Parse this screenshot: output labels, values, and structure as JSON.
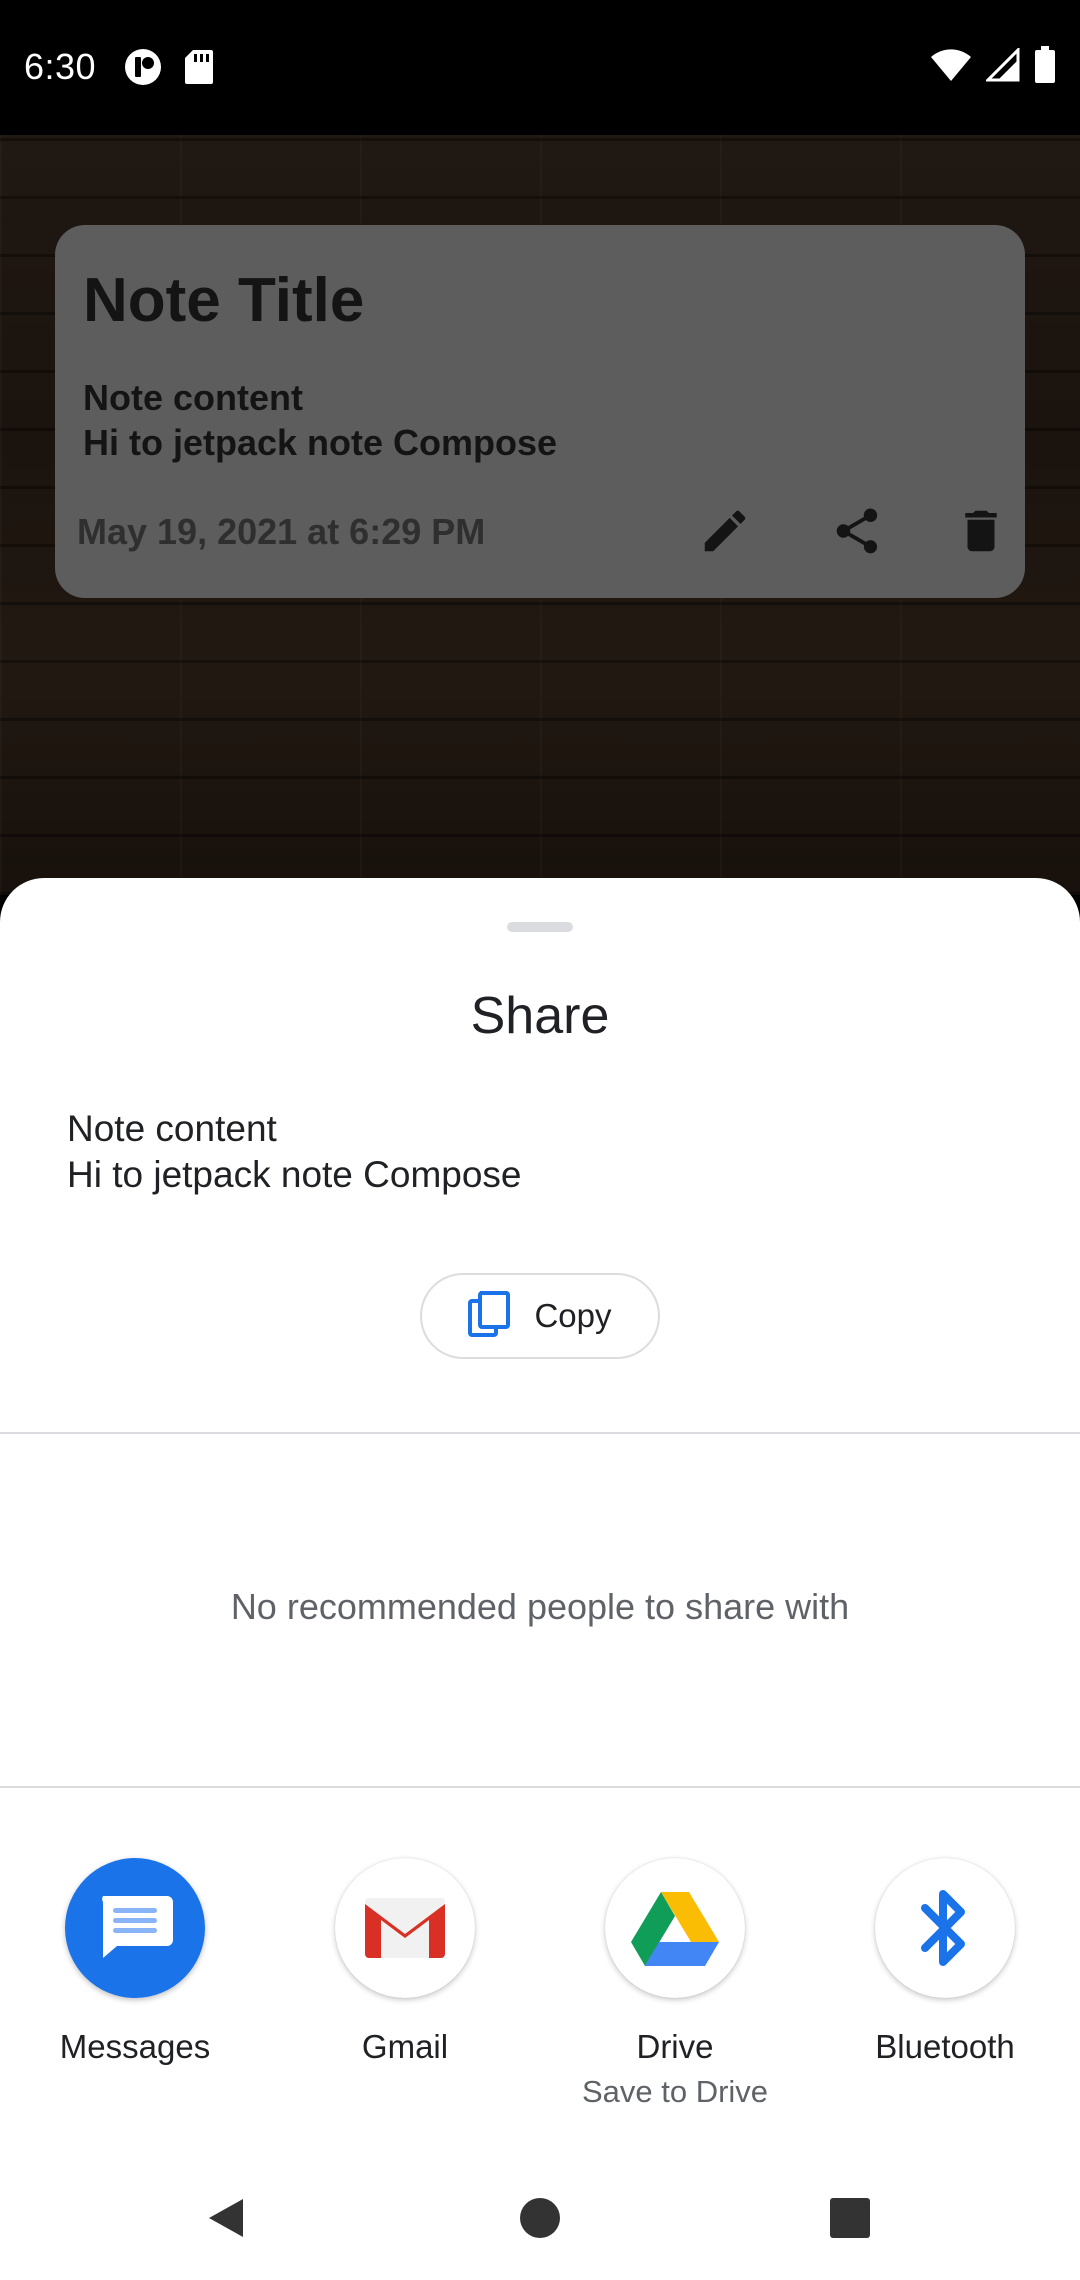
{
  "status_bar": {
    "time": "6:30",
    "icons": [
      "notification-app-icon",
      "sd-card-icon",
      "wifi-icon",
      "cell-signal-icon",
      "battery-icon"
    ]
  },
  "note_card": {
    "title": "Note Title",
    "content": "Note content\nHi to jetpack note Compose",
    "date": "May 19, 2021 at 6:29 PM",
    "actions": [
      "edit-icon",
      "share-icon",
      "delete-icon"
    ]
  },
  "share_sheet": {
    "title": "Share",
    "preview_text": "Note content\nHi to jetpack note Compose",
    "copy_label": "Copy",
    "no_people_text": "No recommended people to share with",
    "targets": [
      {
        "label": "Messages",
        "sublabel": "",
        "icon": "messages-icon"
      },
      {
        "label": "Gmail",
        "sublabel": "",
        "icon": "gmail-icon"
      },
      {
        "label": "Drive",
        "sublabel": "Save to Drive",
        "icon": "drive-icon"
      },
      {
        "label": "Bluetooth",
        "sublabel": "",
        "icon": "bluetooth-icon"
      }
    ]
  },
  "nav_bar": {
    "buttons": [
      "back-icon",
      "home-icon",
      "recents-icon"
    ]
  },
  "colors": {
    "accent_blue": "#1a73e8",
    "sheet_background": "#ffffff",
    "note_card_background": "#5d5d5d"
  }
}
